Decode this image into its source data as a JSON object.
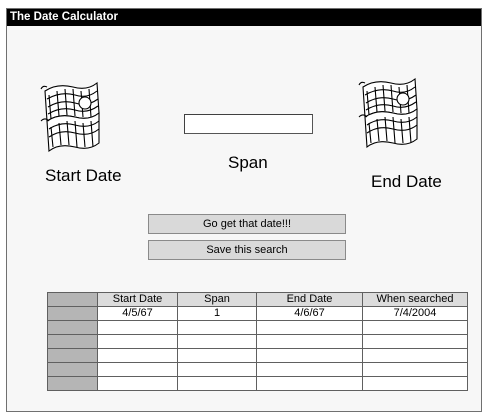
{
  "window": {
    "title": "The Date Calculator"
  },
  "labels": {
    "start_date": "Start Date",
    "span": "Span",
    "end_date": "End Date"
  },
  "span_input": {
    "value": "",
    "placeholder": ""
  },
  "buttons": {
    "go": "Go get that date!!!",
    "save": "Save this search"
  },
  "icons": {
    "start_calendar": "calendar-icon",
    "end_calendar": "calendar-icon"
  },
  "table": {
    "columns": [
      "Start Date",
      "Span",
      "End Date",
      "When searched"
    ],
    "rows": [
      [
        "4/5/67",
        "1",
        "4/6/67",
        "7/4/2004"
      ],
      [
        "",
        "",
        "",
        ""
      ],
      [
        "",
        "",
        "",
        ""
      ],
      [
        "",
        "",
        "",
        ""
      ],
      [
        "",
        "",
        "",
        ""
      ],
      [
        "",
        "",
        "",
        ""
      ]
    ]
  }
}
